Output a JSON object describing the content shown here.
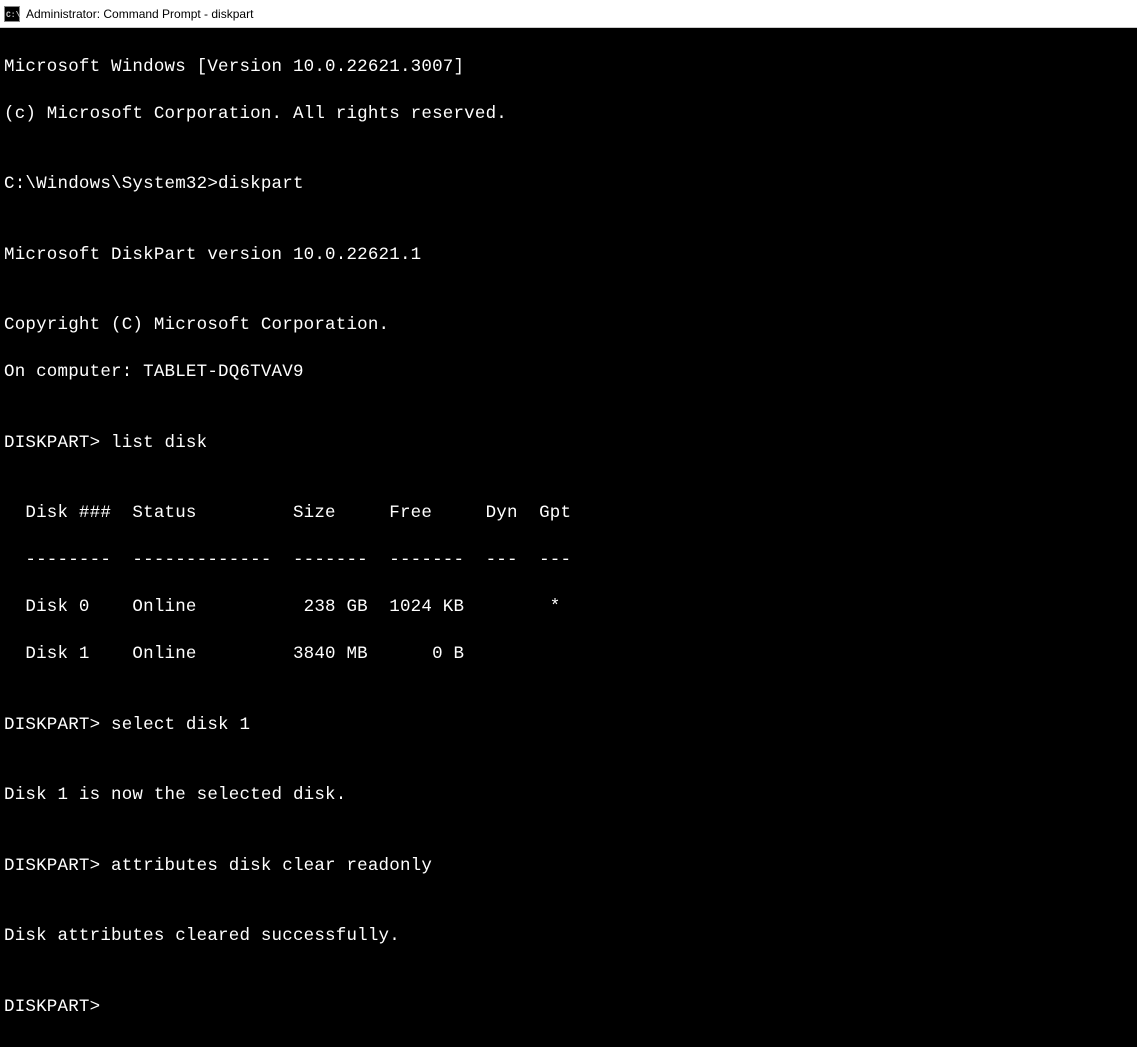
{
  "window": {
    "title": "Administrator: Command Prompt - diskpart"
  },
  "terminal": {
    "header1": "Microsoft Windows [Version 10.0.22621.3007]",
    "header2": "(c) Microsoft Corporation. All rights reserved.",
    "blank": "",
    "prompt1": "C:\\Windows\\System32>diskpart",
    "diskpart_ver": "Microsoft DiskPart version 10.0.22621.1",
    "copyright": "Copyright (C) Microsoft Corporation.",
    "computer": "On computer: TABLET-DQ6TVAV9",
    "cmd_list": "DISKPART> list disk",
    "tbl_header": "  Disk ###  Status         Size     Free     Dyn  Gpt",
    "tbl_divider": "  --------  -------------  -------  -------  ---  ---",
    "tbl_row0": "  Disk 0    Online          238 GB  1024 KB        *",
    "tbl_row1": "  Disk 1    Online         3840 MB      0 B",
    "cmd_select": "DISKPART> select disk 1",
    "msg_select": "Disk 1 is now the selected disk.",
    "cmd_attr": "DISKPART> attributes disk clear readonly",
    "msg_attr": "Disk attributes cleared successfully.",
    "prompt_final": "DISKPART>"
  }
}
